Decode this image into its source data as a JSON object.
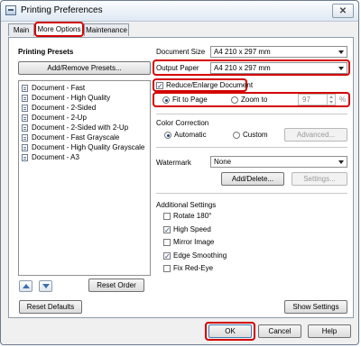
{
  "window": {
    "title": "Printing Preferences",
    "close_glyph": "✕"
  },
  "tabs": [
    {
      "label": "Main"
    },
    {
      "label": "More Options"
    },
    {
      "label": "Maintenance"
    }
  ],
  "presets": {
    "heading": "Printing Presets",
    "add_remove_label": "Add/Remove Presets...",
    "items": [
      "Document - Fast",
      "Document - High Quality",
      "Document - 2-Sided",
      "Document - 2-Up",
      "Document - 2-Sided with 2-Up",
      "Document - Fast Grayscale",
      "Document - High Quality Grayscale",
      "Document - A3"
    ],
    "reset_order_label": "Reset Order"
  },
  "paper": {
    "document_size_label": "Document Size",
    "document_size_value": "A4 210 x 297 mm",
    "output_paper_label": "Output Paper",
    "output_paper_value": "A4 210 x 297 mm",
    "reduce_enlarge_label": "Reduce/Enlarge Document",
    "reduce_enlarge_checked": true,
    "fit_to_page_label": "Fit to Page",
    "zoom_to_label": "Zoom to",
    "zoom_value": "97",
    "zoom_unit": "%"
  },
  "color_correction": {
    "heading": "Color Correction",
    "automatic_label": "Automatic",
    "custom_label": "Custom",
    "advanced_label": "Advanced..."
  },
  "watermark": {
    "label": "Watermark",
    "value": "None",
    "add_delete_label": "Add/Delete...",
    "settings_label": "Settings..."
  },
  "additional": {
    "heading": "Additional Settings",
    "options": [
      {
        "label": "Rotate 180°",
        "checked": false
      },
      {
        "label": "High Speed",
        "checked": true
      },
      {
        "label": "Mirror Image",
        "checked": false
      },
      {
        "label": "Edge Smoothing",
        "checked": true
      },
      {
        "label": "Fix Red-Eye",
        "checked": false
      }
    ]
  },
  "panel_buttons": {
    "reset_defaults_label": "Reset Defaults",
    "show_settings_label": "Show Settings"
  },
  "dialog_buttons": {
    "ok_label": "OK",
    "cancel_label": "Cancel",
    "help_label": "Help"
  },
  "colors": {
    "highlight": "#d40000",
    "accent_blue": "#3d6fb0"
  }
}
